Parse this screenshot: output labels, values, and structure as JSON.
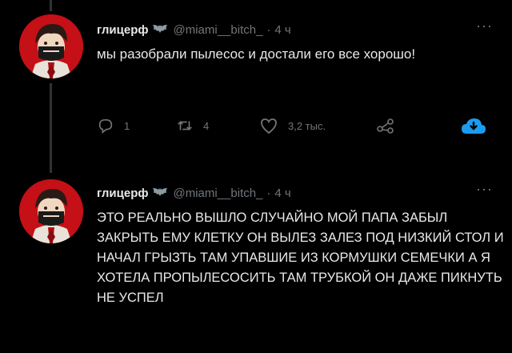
{
  "tweets": [
    {
      "name": "глицерф",
      "handle": "@miami__bitch_",
      "dot": "·",
      "time": "4 ч",
      "more": "···",
      "text": "мы разобрали пылесос и достали его все хорошо!",
      "actions": {
        "replies": "1",
        "retweets": "4",
        "likes": "3,2 тыс."
      }
    },
    {
      "name": "глицерф",
      "handle": "@miami__bitch_",
      "dot": "·",
      "time": "4 ч",
      "more": "···",
      "text": "ЭТО РЕАЛЬНО ВЫШЛО СЛУЧАЙНО МОЙ ПАПА ЗАБЫЛ ЗАКРЫТЬ ЕМУ КЛЕТКУ ОН ВЫЛЕЗ ЗАЛЕЗ ПОД НИЗКИЙ СТОЛ И НАЧАЛ ГРЫЗТЬ ТАМ УПАВШИЕ ИЗ КОРМУШКИ СЕМЕЧКИ А Я ХОТЕЛА ПРОПЫЛЕСОСИТЬ ТАМ ТРУБКОЙ ОН ДАЖЕ ПИКНУТЬ НЕ УСПЕЛ"
    }
  ],
  "colors": {
    "background": "#000000",
    "avatar_bg": "#c41016",
    "muted": "#71767b",
    "text": "#e7e9ea",
    "download_accent": "#1d9bf0"
  },
  "icons": {
    "reply": "reply-icon",
    "retweet": "retweet-icon",
    "like": "heart-icon",
    "share": "share-icon",
    "download": "cloud-download-icon",
    "badge": "bat-emoji-icon"
  }
}
